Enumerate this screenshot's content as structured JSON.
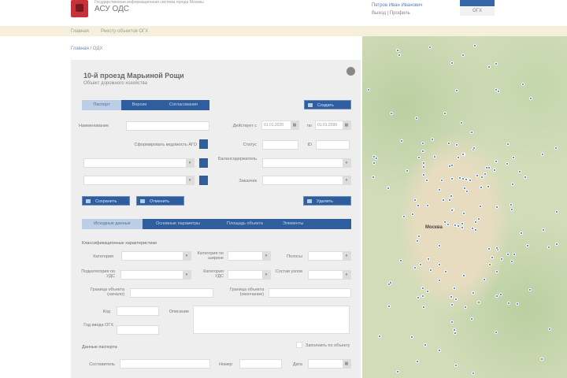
{
  "header": {
    "org": "Государственная информационная система города Москвы",
    "app_title": "АСУ ОДС",
    "user": "Петров Иван Иванович",
    "links": "Выход | Профиль",
    "top_button": "ОГХ"
  },
  "nav": {
    "items": [
      "Главная",
      "Реестр объектов ОГХ"
    ]
  },
  "breadcrumb": {
    "home": "Главная",
    "sep": "/",
    "current": "ОДХ"
  },
  "card": {
    "title": "10-й проезд Марьиной Рощи",
    "subtitle": "Объект дорожного хозяйства",
    "tabs": [
      "Паспорт",
      "Версии",
      "Согласования"
    ],
    "create": "Создать",
    "fields": {
      "name": "Наименование",
      "valid_from": "Действует с",
      "from_value": "01.01.2020",
      "to": "по",
      "to_value": "01.01.2099",
      "status": "Статус",
      "id": "ID",
      "form_report": "Сформировать ведомость АГО",
      "owner": "Балансодержатель",
      "customer": "Заказчик"
    },
    "actions": {
      "save": "Сохранить",
      "cancel": "Отменить",
      "delete": "Удалить"
    },
    "subtabs": [
      "Исходные данные",
      "Основные параметры",
      "Площадь объекта",
      "Элементы"
    ],
    "section_class": "Классификационные характеристики",
    "class_fields": {
      "category": "Категория",
      "width_cat": "Категория по ширине",
      "lanes": "Полосы",
      "subcat": "Подкатегория по УДС",
      "uds_cat": "Категория УДС",
      "nodes": "Состав узлов",
      "start": "Граница объекта (начало)",
      "end": "Граница объекта (окончание)",
      "code": "Код",
      "description": "Описание",
      "year": "Год ввода ОГХ"
    },
    "section_passport": "Данные паспорта",
    "fill_checkbox": "Заполнить по объекту",
    "passport_fields": {
      "author": "Составитель",
      "number": "Номер",
      "date": "Дата"
    }
  },
  "map": {
    "city_label": "Москва"
  },
  "colors": {
    "primary": "#2f5e9e",
    "logo": "#c8303a",
    "nav_bar": "#f6efdc"
  }
}
